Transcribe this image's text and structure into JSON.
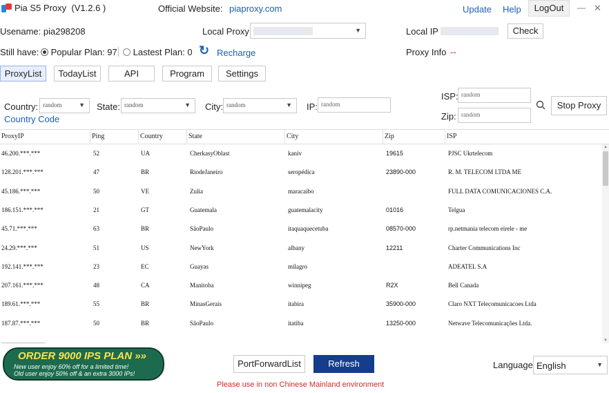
{
  "app": {
    "title": "Pia S5 Proxy",
    "version": "(V1.2.6 )",
    "website_label": "Official Website:",
    "website": "piaproxy.com",
    "update": "Update",
    "help": "Help",
    "logout": "LogOut",
    "minimize": "—",
    "close": "✕"
  },
  "account": {
    "username_label": "Usename: pia298208",
    "local_proxy_label": "Local Proxy",
    "local_ip_label": "Local IP",
    "check_button": "Check",
    "still_have_label": "Still have:",
    "popular_plan": "Popular Plan: 97",
    "lastest_plan": "Lastest Plan: 0",
    "recharge": "Recharge",
    "proxy_info_label": "Proxy Info",
    "proxy_info_value": "--"
  },
  "tabs": [
    "ProxyList",
    "TodayList",
    "API",
    "Program",
    "Settings"
  ],
  "filters": {
    "country_label": "Country:",
    "country_value": "random",
    "state_label": "State:",
    "state_value": "random",
    "city_label": "City:",
    "city_value": "random",
    "ip_label": "IP:",
    "ip_placeholder": "random",
    "isp_label": "ISP:",
    "isp_placeholder": "random",
    "zip_label": "Zip:",
    "zip_placeholder": "random",
    "country_code_link": "Country Code",
    "stop_proxy": "Stop Proxy"
  },
  "table": {
    "columns": [
      "ProxyIP",
      "Ping",
      "Country",
      "State",
      "City",
      "Zip",
      "ISP"
    ],
    "rows": [
      [
        "46.200.***.***",
        "52",
        "UA",
        "CherkasyOblast",
        "kaniv",
        "19615",
        "PJSC Ukrtelecom"
      ],
      [
        "128.201.***.***",
        "47",
        "BR",
        "RiodeJaneiro",
        "seropédica",
        "23890-000",
        "R. M. TELECOM LTDA ME"
      ],
      [
        "45.186.***.***",
        "50",
        "VE",
        "Zulia",
        "maracaibo",
        "",
        "FULL DATA COMUNICACIONES C.A."
      ],
      [
        "186.151.***.***",
        "21",
        "GT",
        "Guatemala",
        "guatemalacity",
        "01016",
        "Telgua"
      ],
      [
        "45.71.***.***",
        "63",
        "BR",
        "SãoPaulo",
        "itaquaquecetuba",
        "08570-000",
        "rp.netmania telecom eirele - me"
      ],
      [
        "24.29.***.***",
        "51",
        "US",
        "NewYork",
        "albany",
        "12211",
        "Charter Communications Inc"
      ],
      [
        "192.141.***.***",
        "23",
        "EC",
        "Guayas",
        "milagro",
        "",
        "ADEATEL S.A"
      ],
      [
        "207.161.***.***",
        "48",
        "CA",
        "Manitoba",
        "winnipeg",
        "R2X",
        "Bell Canada"
      ],
      [
        "189.61.***.***",
        "55",
        "BR",
        "MinasGerais",
        "itabira",
        "35900-000",
        "Claro NXT Telecomunicacoes Ltda"
      ],
      [
        "187.87.***.***",
        "50",
        "BR",
        "SãoPaulo",
        "itatiba",
        "13250-000",
        "Netwave Telecomunicações Ltda."
      ]
    ]
  },
  "promo": {
    "headline": "ORDER 9000 IPS PLAN »»",
    "line1": "New user enjoy 60% off for a limited time!",
    "line2": "Old user enjoy 50% off & an extra 3000 IPs!"
  },
  "footer": {
    "port_forward": "PortForwardList",
    "refresh": "Refresh",
    "language_label": "Language",
    "language_value": "English",
    "notice": "Please use in non Chinese Mainland environment"
  },
  "colors": {
    "accent_blue": "#1a5fb4",
    "refresh_bg": "#163d8c",
    "notice_red": "#d62a2a",
    "promo_green": "#1d6b4f"
  }
}
